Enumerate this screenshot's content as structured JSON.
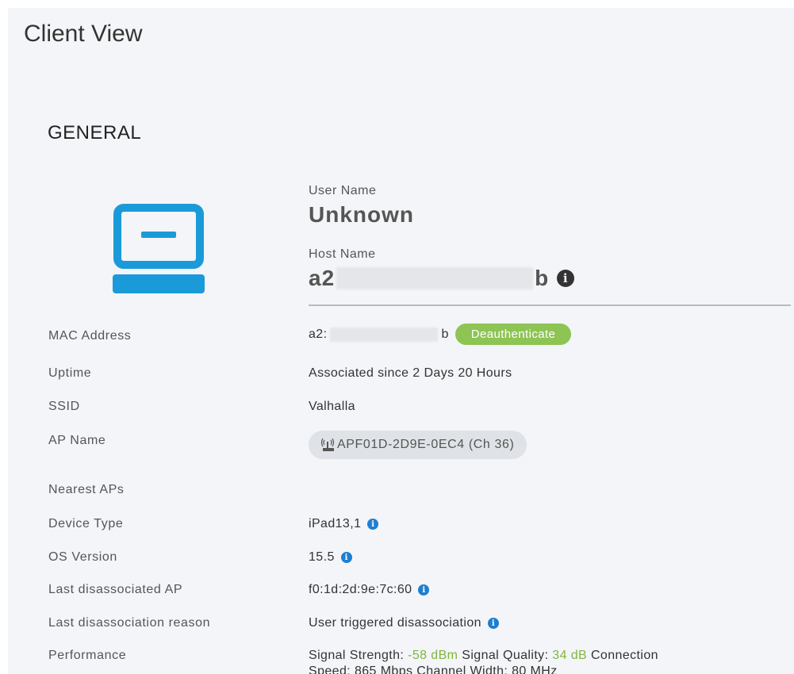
{
  "page": {
    "title": "Client View"
  },
  "general": {
    "section_title": "GENERAL",
    "device_icon": "laptop-icon",
    "user_name_label": "User Name",
    "user_name_value": "Unknown",
    "host_name_label": "Host Name",
    "host_name_prefix": "a2",
    "host_name_suffix": "b",
    "host_name_icon": "info-icon"
  },
  "details": {
    "mac_address": {
      "label": "MAC Address",
      "prefix": "a2:",
      "suffix": "b",
      "action_label": "Deauthenticate"
    },
    "uptime": {
      "label": "Uptime",
      "value": "Associated since 2 Days 20 Hours"
    },
    "ssid": {
      "label": "SSID",
      "value": "Valhalla"
    },
    "ap_name": {
      "label": "AP Name",
      "value": "APF01D-2D9E-0EC4 (Ch 36)",
      "icon": "access-point-icon"
    },
    "nearest_aps": {
      "label": "Nearest APs"
    },
    "device_type": {
      "label": "Device Type",
      "value": "iPad13,1"
    },
    "os_version": {
      "label": "OS Version",
      "value": "15.5"
    },
    "last_disassociated_ap": {
      "label": "Last disassociated AP",
      "value": "f0:1d:2d:9e:7c:60"
    },
    "last_disassociation_reason": {
      "label": "Last disassociation reason",
      "value": "User triggered disassociation"
    },
    "performance": {
      "label": "Performance",
      "signal_strength_label": "Signal Strength:",
      "signal_strength_value": "-58 dBm",
      "signal_quality_label": "Signal Quality:",
      "signal_quality_value": "34 dB",
      "connection_label": "Connection",
      "line2": "Speed: 865 Mbps Channel Width: 80 MHz"
    }
  },
  "colors": {
    "accent_blue": "#1b9ad9",
    "green": "#8dc453",
    "info_blue": "#1e7fd0"
  }
}
